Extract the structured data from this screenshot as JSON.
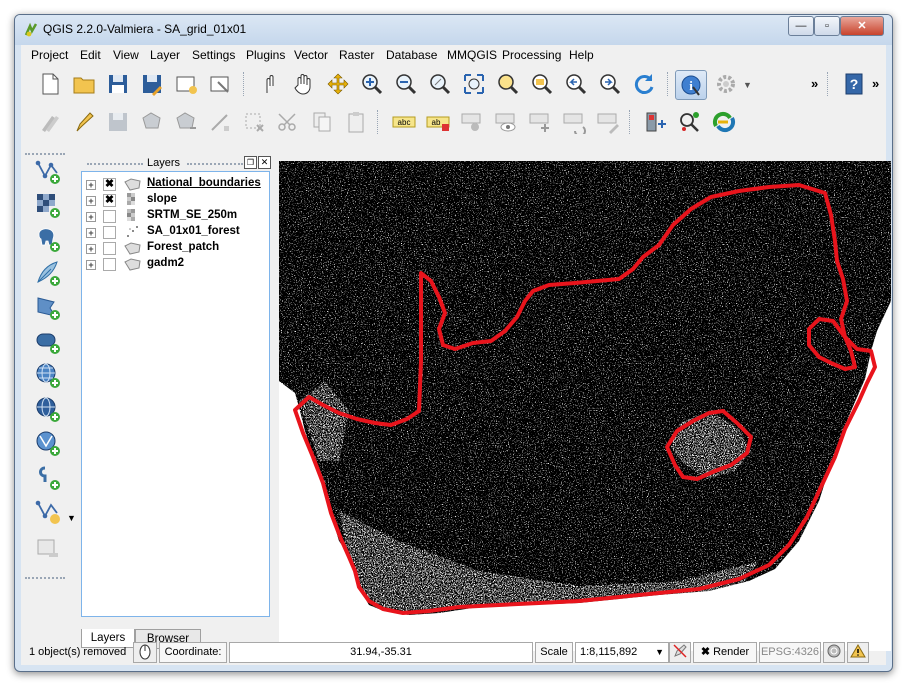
{
  "window": {
    "title": "QGIS 2.2.0-Valmiera - SA_grid_01x01",
    "controls": {
      "minimize": "—",
      "maximize": "▫",
      "close": "✕"
    }
  },
  "menubar": {
    "items": [
      "Project",
      "Edit",
      "View",
      "Layer",
      "Settings",
      "Plugins",
      "Vector",
      "Raster",
      "Database",
      "MMQGIS",
      "Processing",
      "Help"
    ]
  },
  "toolbar": {
    "overflow": "»"
  },
  "layers_panel": {
    "title": "Layers",
    "layers": [
      {
        "name": "National_boundaries",
        "visible": "✖",
        "icon": "polygon-layer-icon"
      },
      {
        "name": "slope",
        "visible": "✖",
        "icon": "raster-layer-icon"
      },
      {
        "name": "SRTM_SE_250m",
        "visible": "",
        "icon": "raster-layer-icon"
      },
      {
        "name": "SA_01x01_forest",
        "visible": "",
        "icon": "point-layer-icon"
      },
      {
        "name": "Forest_patch",
        "visible": "",
        "icon": "polygon-layer-icon"
      },
      {
        "name": "gadm2",
        "visible": "",
        "icon": "polygon-layer-icon"
      }
    ],
    "tabs": [
      "Layers",
      "Browser"
    ]
  },
  "statusbar": {
    "message": "1 object(s) removed",
    "coordinate_label": "Coordinate:",
    "coordinate_value": "31.94,-35.31",
    "scale_label": "Scale",
    "scale_value": "1:8,115,892",
    "render_label": "Render",
    "crs": "EPSG:4326"
  },
  "colors": {
    "boundary": "#e8141c",
    "map_background": "#000000",
    "selected_tab_border": "#7eb4ea"
  }
}
